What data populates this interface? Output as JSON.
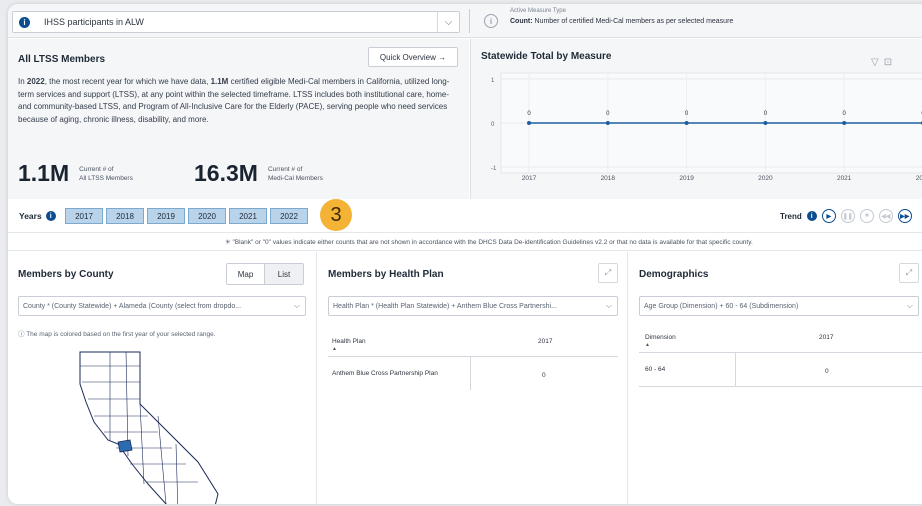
{
  "filter": {
    "measure_selected": "IHSS participants in ALW",
    "active_measure_label": "Active Measure Type",
    "active_measure_desc_prefix": "Count:",
    "active_measure_desc": "Number of certified Medi-Cal members as per selected measure"
  },
  "ltss": {
    "title": "All LTSS Members",
    "quick_overview": "Quick Overview →",
    "text_1": "In ",
    "text_year": "2022",
    "text_2": ", the most recent year for which we have data, ",
    "text_count": "1.1M",
    "text_3": " certified eligible Medi-Cal members in California, utilized long-term services and support (LTSS), at any point within the selected timeframe. LTSS includes both institutional care, home- and community-based LTSS, and Program of All-Inclusive Care for the Elderly (PACE), serving people who need services because of aging, chronic illness, disability, and more.",
    "stat1_value": "1.1M",
    "stat1_label_1": "Current # of",
    "stat1_label_2": "All LTSS Members",
    "stat2_value": "16.3M",
    "stat2_label_1": "Current # of",
    "stat2_label_2": "Medi-Cal Members"
  },
  "chart_data": {
    "type": "line",
    "title": "Statewide Total by Measure",
    "x": [
      "2017",
      "2018",
      "2019",
      "2020",
      "2021",
      "2022"
    ],
    "series": [
      {
        "values": [
          0,
          0,
          0,
          0,
          0,
          0
        ]
      }
    ],
    "y_ticks": [
      "1",
      "0",
      "-1"
    ],
    "ylim": [
      -1,
      1
    ],
    "grid": true,
    "color": "#1f5fa0"
  },
  "years": {
    "label": "Years",
    "items": [
      "2017",
      "2018",
      "2019",
      "2020",
      "2021",
      "2022"
    ],
    "step_badge": "3",
    "trend_label": "Trend"
  },
  "notice": "\"Blank\" or \"0\" values indicate either counts that are not shown in accordance with the DHCS Data De-identification Guidelines v2.2 or that no data is available for that specific county.",
  "county": {
    "title": "Members by County",
    "map_label": "Map",
    "list_label": "List",
    "dropdown": "County * (County Statewide) + Alameda (County (select from dropdo...",
    "map_note": "The map is colored based on the first year of your selected range."
  },
  "health_plan": {
    "title": "Members by Health Plan",
    "dropdown": "Health Plan * (Health Plan Statewide) + Anthem Blue Cross Partnershi...",
    "col_header": "Health Plan",
    "year_header": "2017",
    "row_name": "Anthem Blue Cross Partnership Plan",
    "row_value": "0"
  },
  "demographics": {
    "title": "Demographics",
    "dropdown": "Age Group (Dimension) + 60 - 64 (Subdimension)",
    "col_header": "Dimension",
    "year_header": "2017",
    "row_name": "60 - 64",
    "row_value": "0"
  }
}
